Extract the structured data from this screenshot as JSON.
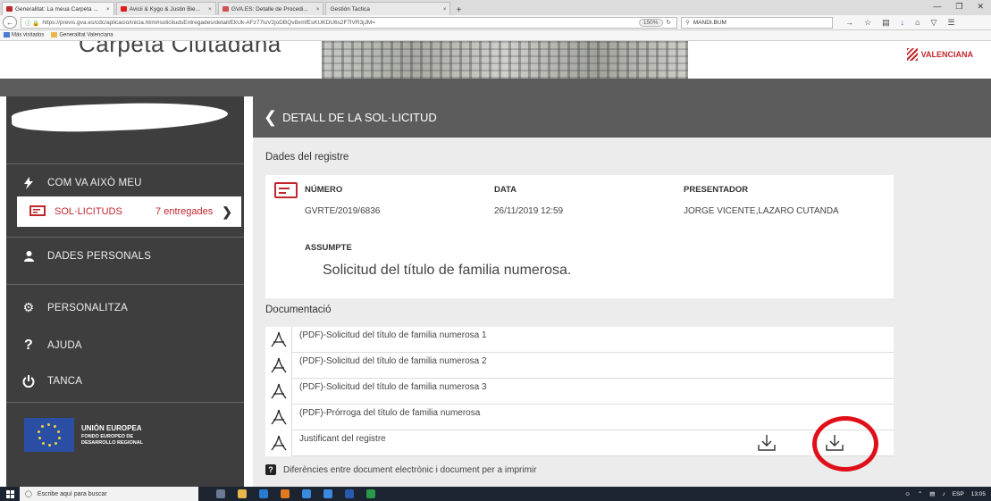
{
  "browser": {
    "tabs": [
      {
        "label": "Generalitat: La meua Carpeta ...",
        "active": true,
        "color": "#c0272d"
      },
      {
        "label": "Avicii & Kygo & Justin Bie...",
        "active": false,
        "color": "#e02020"
      },
      {
        "label": "GVA.ES: Detalle de Procedi...",
        "active": false,
        "color": "#d05050"
      },
      {
        "label": "Gestión Tactica",
        "active": false,
        "color": "#888888"
      }
    ],
    "close_glyph": "×",
    "new_tab": "+",
    "url": "https://previs.gva.es/cdc/aplicacio/inicia.html#solicitudsEntregades/detail/EkUk-AFz77luV2joDBQv8xmfEsKUKDU6s2F7lVR3jJM=",
    "zoom": "150%",
    "search_value": "MANDI.BUM",
    "bookmarks": [
      "Más visitados",
      "Generalitat Valenciana"
    ]
  },
  "site": {
    "title": "Carpeta Ciutadana",
    "logo_text": "VALENCIANA"
  },
  "sidebar": {
    "items": [
      {
        "label": "COM VA AIXÒ MEU",
        "icon": "lightning-icon"
      },
      {
        "label": "DADES PERSONALS",
        "icon": "person-icon"
      },
      {
        "label": "PERSONALITZA",
        "icon": "gear-icon"
      },
      {
        "label": "AJUDA",
        "icon": "question-icon"
      },
      {
        "label": "TANCA",
        "icon": "power-icon"
      }
    ],
    "sub_item": {
      "label": "SOL·LICITUDS",
      "count": "7 entregades"
    },
    "eu": {
      "title": "UNIÓN EUROPEA",
      "line1": "FONDO EUROPEO DE",
      "line2": "DESARROLLO REGIONAL"
    }
  },
  "main": {
    "header": "DETALL DE LA SOL·LICITUD",
    "registry_title": "Dades del registre",
    "columns": {
      "numero_label": "NÚMERO",
      "numero_value": "GVRTE/2019/6836",
      "data_label": "DATA",
      "data_value": "26/11/2019 12:59",
      "presentador_label": "PRESENTADOR",
      "presentador_value": "JORGE VICENTE,LAZARO CUTANDA"
    },
    "subject_label": "ASSUMPTE",
    "subject_value": "Solicitud del título de familia numerosa.",
    "docs_title": "Documentació",
    "documents": [
      "(PDF)-Solicitud del título de familia numerosa 1",
      "(PDF)-Solicitud del título de familia numerosa 2",
      "(PDF)-Solicitud del título de familia numerosa 3",
      "(PDF)-Prórroga del título de familia numerosa",
      "Justificant del registre"
    ],
    "differences_link": "Diferències entre document electrònic i document per a imprimir"
  },
  "taskbar": {
    "search_placeholder": "Escribe aquí para buscar",
    "lang": "ESP",
    "time": "13:05"
  },
  "colors": {
    "accent_red": "#c0272d",
    "sidebar_bg": "#3e3e3e",
    "header_bg": "#5c5c5c"
  }
}
